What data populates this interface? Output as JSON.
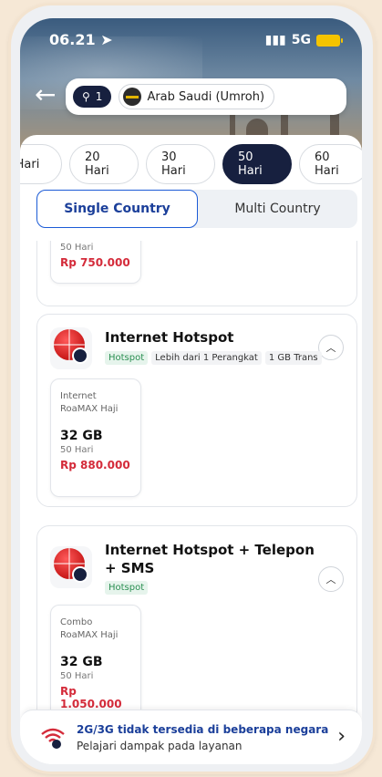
{
  "status_bar": {
    "time": "06.21",
    "network": "5G"
  },
  "search": {
    "count": "1",
    "destination": "Arab Saudi (Umroh)"
  },
  "day_tabs": [
    "Hari",
    "20 Hari",
    "30 Hari",
    "50 Hari",
    "60 Hari"
  ],
  "active_day_tab": "50 Hari",
  "country_toggle": {
    "single": "Single Country",
    "multi": "Multi Country"
  },
  "cards": [
    {
      "partial": true,
      "pkg": {
        "days": "50 Hari",
        "price": "Rp 750.000"
      }
    },
    {
      "title": "Internet Hotspot",
      "tags": [
        {
          "label": "Hotspot",
          "style": "green"
        },
        {
          "label": "Lebih dari 1 Perangkat",
          "style": "gray"
        },
        {
          "label": "1 GB Trans",
          "style": "gray"
        }
      ],
      "pkg": {
        "type_line1": "Internet",
        "type_line2": "RoaMAX Haji",
        "quota": "32 GB",
        "days": "50 Hari",
        "price": "Rp 880.000"
      }
    },
    {
      "title_line1": "Internet Hotspot + Telepon",
      "title_line2": "+ SMS",
      "tags": [
        {
          "label": "Hotspot",
          "style": "green"
        }
      ],
      "pkg": {
        "type_line1": "Combo",
        "type_line2": "RoaMAX Haji",
        "quota": "32 GB",
        "days": "50 Hari",
        "price": "Rp 1.050.000"
      }
    }
  ],
  "notice": {
    "title": "2G/3G tidak tersedia di beberapa negara",
    "subtitle": "Pelajari dampak pada layanan"
  },
  "colors": {
    "navy": "#17203f",
    "accent_blue": "#1b5bd6",
    "price_red": "#d42b3a",
    "tag_green": "#2b8f52"
  },
  "icons": [
    "back-arrow-icon",
    "search-icon",
    "flag-icon",
    "globe-icon",
    "hotspot-icon",
    "chevron-up-icon",
    "signal-warning-icon",
    "chevron-right-icon",
    "location-arrow-icon",
    "battery-icon"
  ]
}
